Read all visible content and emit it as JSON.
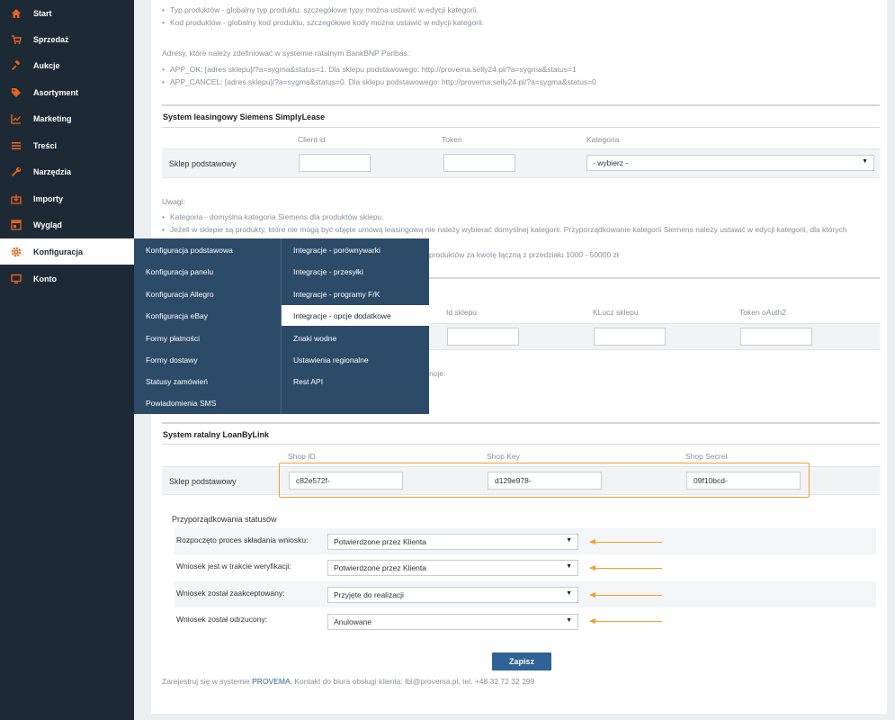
{
  "sidebar": {
    "items": [
      {
        "label": "Start",
        "icon": "home-icon"
      },
      {
        "label": "Sprzedaż",
        "icon": "cart-icon"
      },
      {
        "label": "Aukcje",
        "icon": "gavel-icon"
      },
      {
        "label": "Asortyment",
        "icon": "tag-icon"
      },
      {
        "label": "Marketing",
        "icon": "chart-icon"
      },
      {
        "label": "Treści",
        "icon": "list-icon"
      },
      {
        "label": "Narzędzia",
        "icon": "wrench-icon"
      },
      {
        "label": "Importy",
        "icon": "import-icon"
      },
      {
        "label": "Wygląd",
        "icon": "layout-icon"
      },
      {
        "label": "Konfiguracja",
        "icon": "gear-icon",
        "active": true
      },
      {
        "label": "Konto",
        "icon": "monitor-icon"
      }
    ]
  },
  "top_section": {
    "bullets_a": [
      "Typ produktów - globalny typ produktu, szczegółowe typy można ustawić w edycji kategorii.",
      "Kod produktów - globalny kod produktu, szczegółowe kody można ustawić w edycji kategorii."
    ],
    "addresses_title": "Adresy, które należy zdefiniować w systemie ratalnym BankBNP Paribas:",
    "bullets_b": [
      "APP_OK: [adres sklepu]/?a=sygma&status=1. Dla sklepu podstawowego: http://provema.selly24.pl/?a=sygma&status=1",
      "APP_CANCEL: [adres sklepu]/?a=sygma&status=0. Dla sklepu podstawowego: http://provema.selly24.pl/?a=sygma&status=0"
    ]
  },
  "siemens": {
    "title": "System leasingowy Siemens SimplyLease",
    "columns": [
      "Client id",
      "Token",
      "Kategoria"
    ],
    "row_label": "Sklep podstawowy",
    "category_value": "- wybierz -",
    "notes_title": "Uwagi:",
    "notes": [
      "Kategoria - domyślna kategoria Siemens dla produktów sklepu.",
      "Jeżeli w sklepie są produkty, które nie mogą być objęte umową leasingową nie należy wybierać domyślnej kategorii. Przyporządkowanie kategorii Siemens należy ustawić w edycji kategorii, dla których"
    ],
    "note_tail": "produktów za kwotę łączną z przedziału 1000 - 50000 zł"
  },
  "hidden_section": {
    "columns": [
      "Id sklepu",
      "KLucz sklepu",
      "Token oAuth2"
    ],
    "fragment": "noje:"
  },
  "loanbylink": {
    "title": "System ratalny LoanByLink",
    "columns": [
      "Shop ID",
      "Shop Key",
      "Shop Secret"
    ],
    "row_label": "Sklep podstawowy",
    "values": [
      "c82e572f-",
      "d129e978-",
      "09f10bcd-"
    ],
    "highlight_color": "#f0a02a"
  },
  "statuses": {
    "title": "Przyporządkowania statusów",
    "rows": [
      {
        "label": "Rozpoczęto proces składania wniosku:",
        "value": "Potwierdzone przez Klienta"
      },
      {
        "label": "Wniosek jest w trakcie weryfikacji:",
        "value": "Potwierdzone przez Klienta"
      },
      {
        "label": "Wniosek został zaakceptowany:",
        "value": "Przyjęte do realizacji"
      },
      {
        "label": "Wniosek został odrzucony:",
        "value": "Anulowane"
      }
    ]
  },
  "save_label": "Zapisz",
  "footer": {
    "prefix": "Zarejestruj się w systemie ",
    "link": "PROVEMA",
    "suffix": ". Kontakt do biura obsługi klienta: lbl@provema.pl, tel. +48 32 72 32 299"
  },
  "dropdown": {
    "left": [
      "Konfiguracja podstawowa",
      "Konfiguracja panelu",
      "Konfiguracja Allegro",
      "Konfiguracja eBay",
      "Formy płatności",
      "Formy dostawy",
      "Statusy zamówień",
      "Powiadomienia SMS"
    ],
    "right": [
      "Integracje - porównywarki",
      "Integracje - przesyłki",
      "Integracje - programy F/K",
      "Integracje - opcje dodatkowe",
      "Znaki wodne",
      "Ustawienia regionalne",
      "Rest API"
    ],
    "active_right": "Integracje - opcje dodatkowe"
  },
  "colors": {
    "sidebar_bg": "#1d2a36",
    "accent": "#e8621b",
    "dropdown_bg": "#2c4b68",
    "button_bg": "#2f6296",
    "link": "#2f6296"
  }
}
